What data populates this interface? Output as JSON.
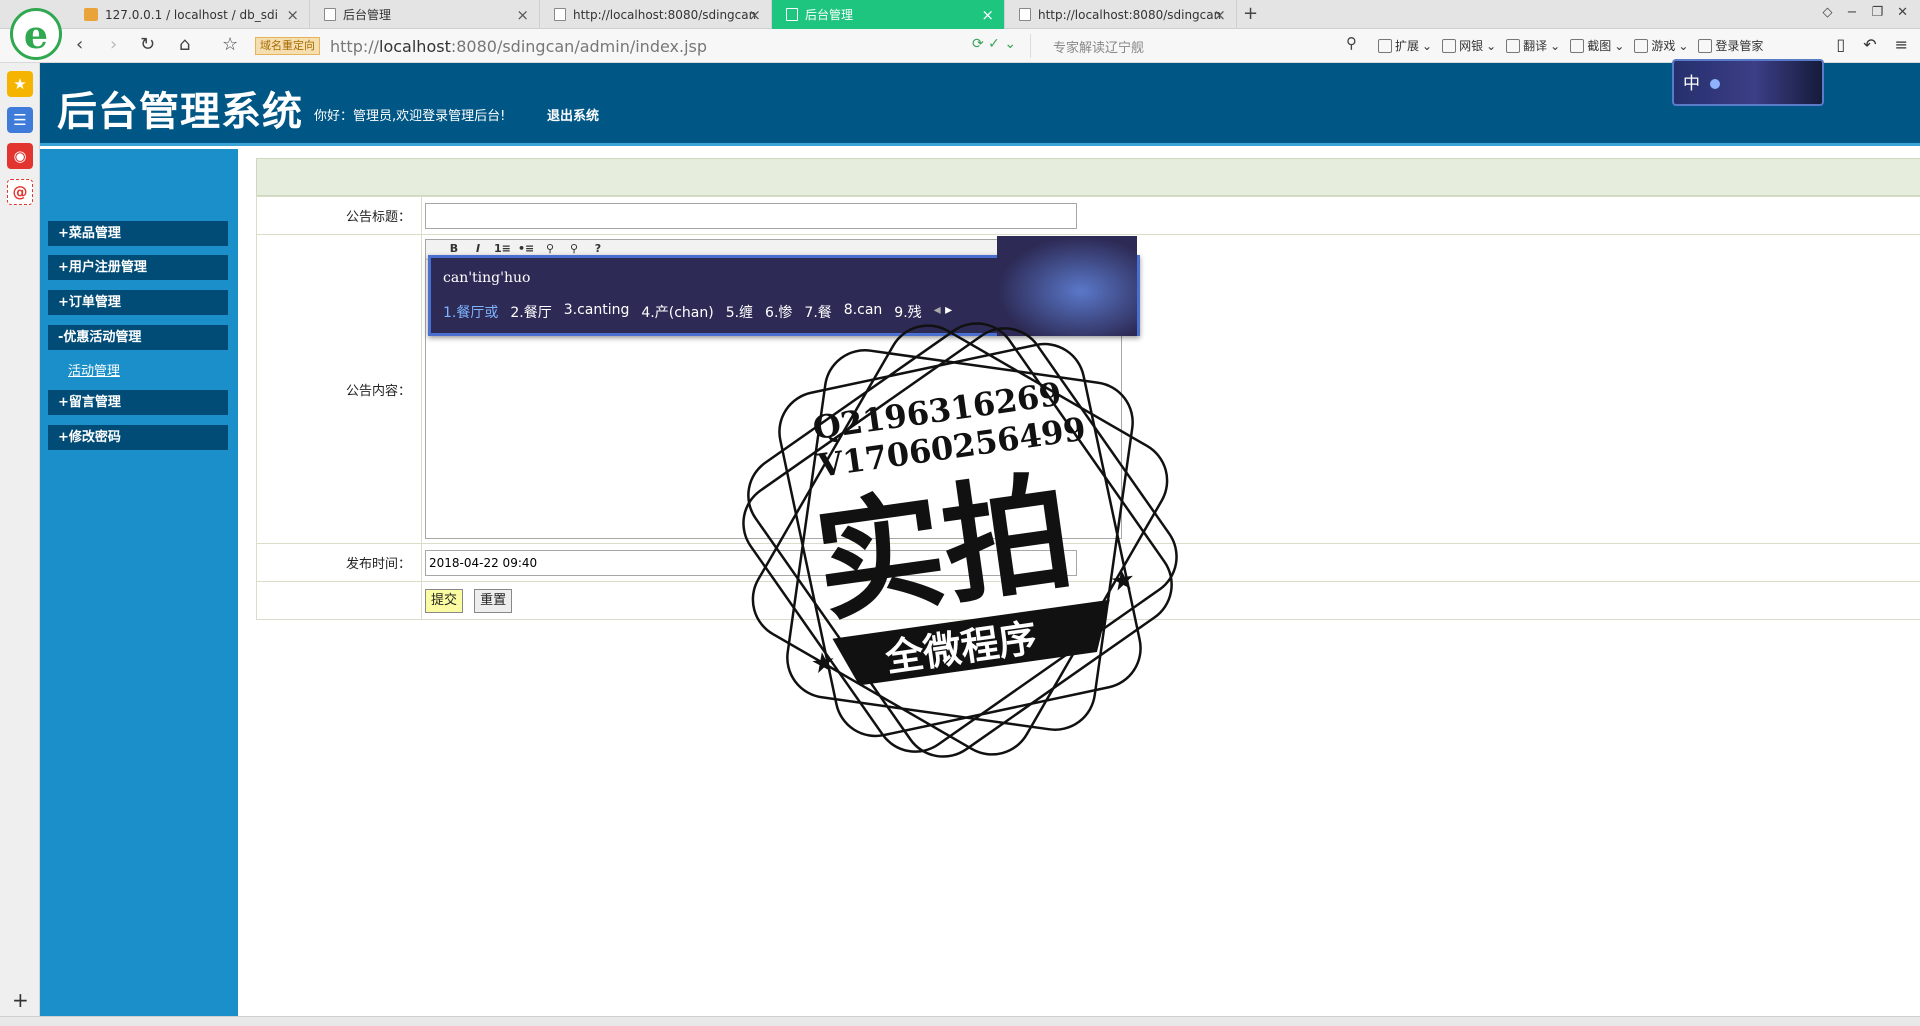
{
  "tabs": [
    {
      "title": "127.0.0.1 / localhost / db_sdi",
      "active": false,
      "favicon": "pma-icon"
    },
    {
      "title": "后台管理",
      "active": false,
      "favicon": "page-icon"
    },
    {
      "title": "http://localhost:8080/sdingcan",
      "active": false,
      "favicon": "page-icon"
    },
    {
      "title": "后台管理",
      "active": true,
      "favicon": "page-icon"
    },
    {
      "title": "http://localhost:8080/sdingcan",
      "active": false,
      "favicon": "page-icon"
    }
  ],
  "address": {
    "redirect_badge": "域名重定向",
    "url_prefix": "http://",
    "url_host": "localhost",
    "url_rest": ":8080/sdingcan/admin/index.jsp",
    "search_placeholder": "专家解读辽宁舰"
  },
  "toolbar": {
    "extensions": "扩展",
    "bank": "网银",
    "translate": "翻译",
    "screenshot": "截图",
    "games": "游戏",
    "login_manager": "登录管家"
  },
  "admin": {
    "title": "后台管理系统",
    "welcome": "你好：管理员,欢迎登录管理后台!",
    "logout": "退出系统",
    "ime_status_char": "中"
  },
  "menu": {
    "dish": "+菜品管理",
    "user_reg": "+用户注册管理",
    "order": "+订单管理",
    "promo": "-优惠活动管理",
    "promo_sub": "活动管理",
    "message": "+留言管理",
    "password": "+修改密码"
  },
  "form": {
    "title_label": "公告标题：",
    "title_value": "",
    "content_label": "公告内容：",
    "time_label": "发布时间：",
    "time_value": "2018-04-22 09:40",
    "submit": "提交",
    "reset": "重置"
  },
  "editor_tools": [
    "B",
    "I",
    "1≡",
    "•≡",
    "⚲",
    "⚲",
    "?"
  ],
  "ime": {
    "pinyin": "can'ting'huo",
    "candidates": [
      "1.餐厅或",
      "2.餐厅",
      "3.canting",
      "4.产(chan)",
      "5.缠",
      "6.惨",
      "7.餐",
      "8.can",
      "9.残"
    ]
  },
  "watermark": {
    "line1": "Q2196316269",
    "line2": "V17060256499",
    "big": "实拍",
    "banner": "全微程序"
  }
}
